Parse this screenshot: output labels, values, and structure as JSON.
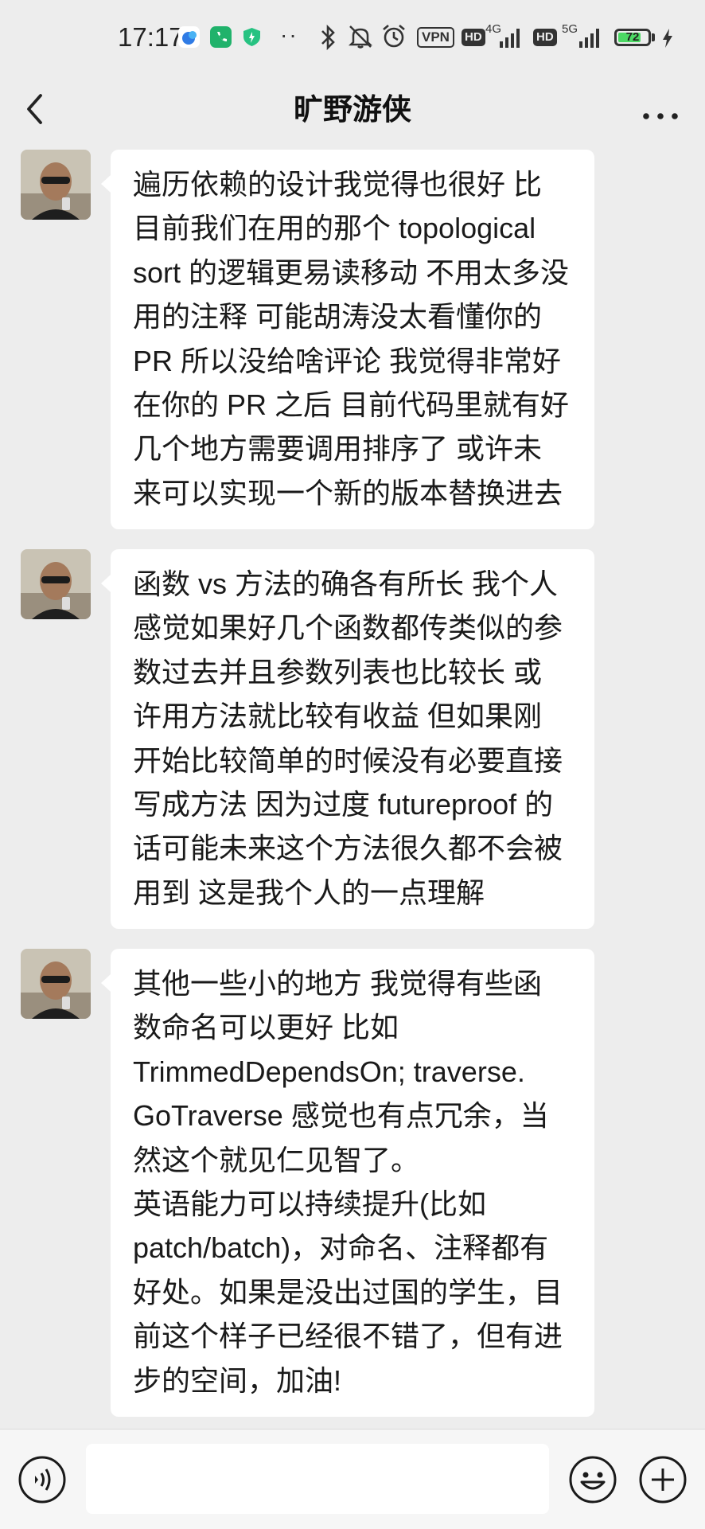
{
  "status_bar": {
    "time": "17:17",
    "vpn_label": "VPN",
    "hd_label": "HD",
    "network_1": "4G",
    "network_2": "5G",
    "battery_level": "72"
  },
  "nav": {
    "title": "旷野游侠"
  },
  "messages": [
    {
      "sender": "旷野游侠",
      "lines": [
        "遍历依赖的设计我觉得也很好 比",
        "目前我们在用的那个 topological",
        "sort 的逻辑更易读移动 不用太多没",
        "用的注释 可能胡涛没太看懂你的",
        "PR 所以没给啥评论 我觉得非常好",
        "在你的 PR 之后 目前代码里就有好",
        "几个地方需要调用排序了 或许未",
        "来可以实现一个新的版本替换进去"
      ]
    },
    {
      "sender": "旷野游侠",
      "lines": [
        "函数 vs 方法的确各有所长 我个人",
        "感觉如果好几个函数都传类似的参",
        "数过去并且参数列表也比较长 或",
        "许用方法就比较有收益 但如果刚",
        "开始比较简单的时候没有必要直接",
        "写成方法 因为过度 futureproof 的",
        "话可能未来这个方法很久都不会被",
        "用到 这是我个人的一点理解"
      ]
    },
    {
      "sender": "旷野游侠",
      "lines": [
        "其他一些小的地方 我觉得有些函",
        "数命名可以更好 比如",
        "TrimmedDependsOn; traverse.",
        "GoTraverse 感觉也有点冗余，当",
        "然这个就见仁见智了。",
        "英语能力可以持续提升(比如",
        "patch/batch)，对命名、注释都有",
        "好处。如果是没出过国的学生，目",
        "前这个样子已经很不错了，但有进",
        "步的空间，加油!"
      ]
    }
  ],
  "input_bar": {
    "placeholder": "",
    "value": ""
  },
  "colors": {
    "background": "#ededed",
    "bubble": "#ffffff",
    "battery": "#4cd964"
  }
}
